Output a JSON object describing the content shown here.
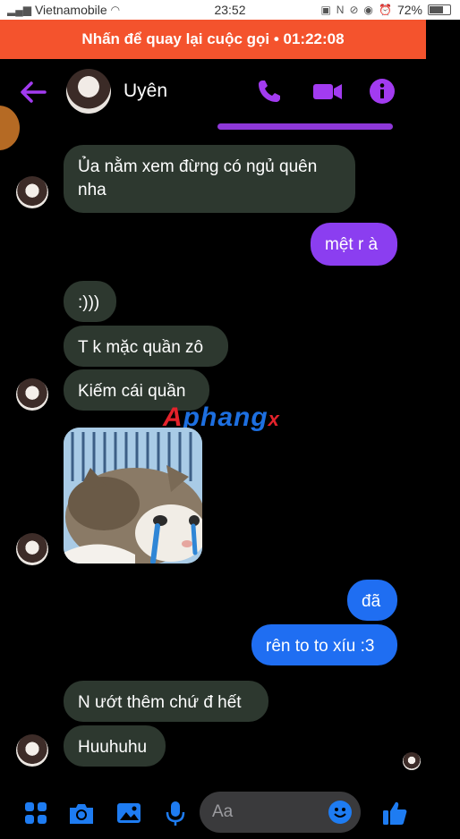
{
  "status_bar": {
    "carrier": "Vietnamobile",
    "time": "23:52",
    "battery": "72%",
    "battery_level": 0.72
  },
  "call_banner": {
    "text": "Nhấn để quay lại cuộc gọi • 01:22:08"
  },
  "header": {
    "contact_name": "Uyên",
    "accent_color": "#a23bf0"
  },
  "messages": [
    {
      "side": "in",
      "text": "Ủa nằm xem đừng có ngủ quên nha"
    },
    {
      "side": "out",
      "text": "mệt r à"
    },
    {
      "side": "in",
      "text": ":)))"
    },
    {
      "side": "in",
      "text": "T k mặc quần zô"
    },
    {
      "side": "in",
      "text": "Kiếm cái quần"
    },
    {
      "side": "in",
      "type": "image",
      "text": ""
    },
    {
      "side": "out",
      "text": "đã"
    },
    {
      "side": "out",
      "text": "rên to to xíu :3"
    },
    {
      "side": "in",
      "text": "N ướt thêm chứ đ hết"
    },
    {
      "side": "in",
      "text": "Huuhuhu"
    }
  ],
  "watermark": {
    "part1": "A",
    "part2": "phang",
    "part3": "x"
  },
  "composer": {
    "placeholder": "Aa",
    "accent_color": "#1e7cf2"
  }
}
